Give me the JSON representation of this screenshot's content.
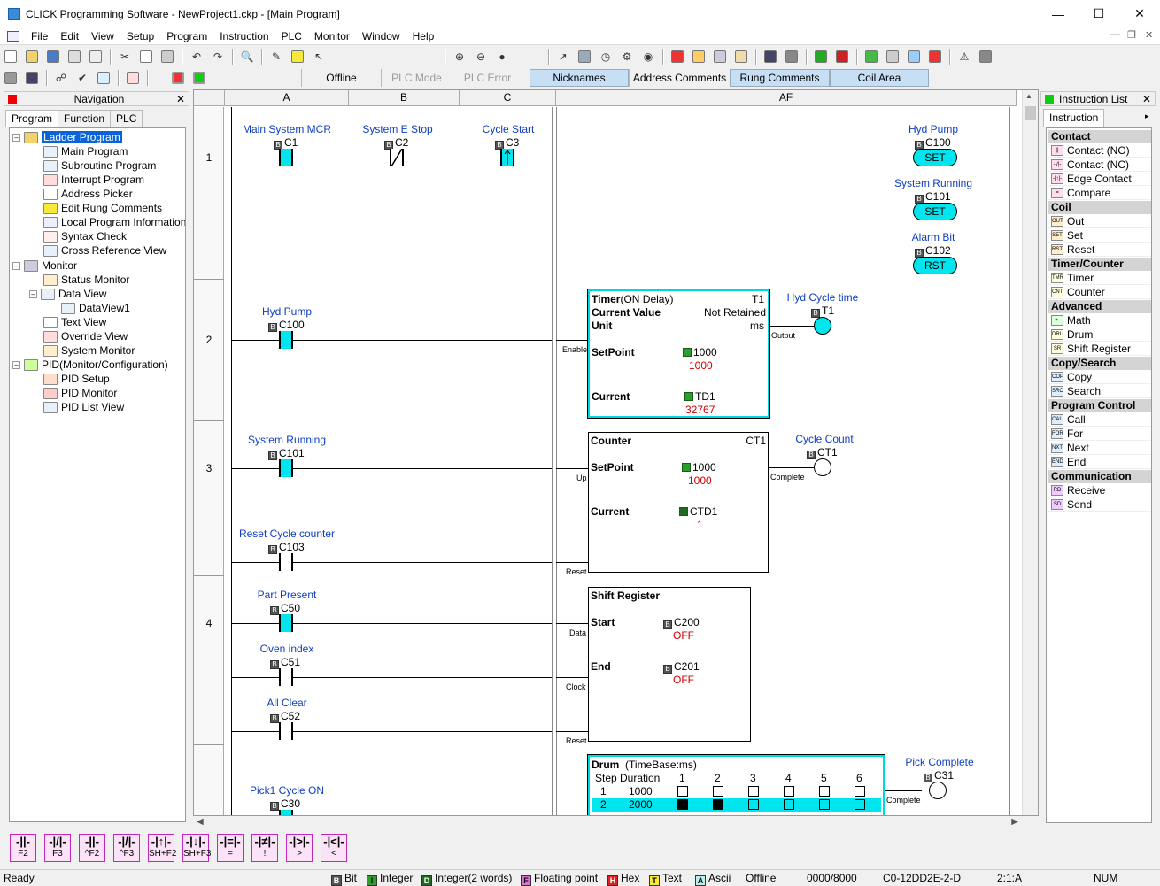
{
  "window": {
    "title": "CLICK Programming Software - NewProject1.ckp - [Main Program]"
  },
  "menu": [
    "File",
    "Edit",
    "View",
    "Setup",
    "Program",
    "Instruction",
    "PLC",
    "Monitor",
    "Window",
    "Help"
  ],
  "statusbar_top": {
    "offline": "Offline",
    "plc_mode": "PLC Mode",
    "plc_error": "PLC Error"
  },
  "view_buttons": {
    "nicknames": "Nicknames",
    "address_comments": "Address Comments",
    "rung_comments": "Rung Comments",
    "coil_area": "Coil Area"
  },
  "nav": {
    "title": "Navigation",
    "tabs": [
      "Program",
      "Function",
      "PLC"
    ],
    "tree": {
      "ladder": "Ladder Program",
      "main": "Main Program",
      "sub": "Subroutine Program",
      "interrupt": "Interrupt Program",
      "picker": "Address Picker",
      "rungcomments": "Edit Rung Comments",
      "local": "Local Program Information",
      "syntax": "Syntax Check",
      "xref": "Cross Reference View",
      "monitor": "Monitor",
      "status": "Status Monitor",
      "dataview": "Data View",
      "dataview1": "DataView1",
      "textview": "Text View",
      "override": "Override View",
      "sysmon": "System Monitor",
      "pid": "PID(Monitor/Configuration)",
      "pidsetup": "PID Setup",
      "pidmon": "PID Monitor",
      "pidlist": "PID List View"
    }
  },
  "ladder": {
    "cols": {
      "a": "A",
      "b": "B",
      "c": "C",
      "af": "AF"
    },
    "rungs": [
      "1",
      "2",
      "3",
      "4"
    ],
    "r1": {
      "c1_lbl": "Main System MCR",
      "c1": "C1",
      "c2_lbl": "System E Stop",
      "c2": "C2",
      "c3_lbl": "Cycle Start",
      "c3": "C3",
      "o1_lbl": "Hyd Pump",
      "o1": "C100",
      "o1_type": "SET",
      "o2_lbl": "System Running",
      "o2": "C101",
      "o2_type": "SET",
      "o3_lbl": "Alarm Bit",
      "o3": "C102",
      "o3_type": "RST"
    },
    "r2": {
      "c_lbl": "Hyd Pump",
      "c": "C100",
      "enable": "Enable",
      "output": "Output",
      "timer_title": "Timer",
      "timer_mode": "(ON Delay)",
      "timer_id": "T1",
      "cv": "Current Value",
      "retained": "Not Retained",
      "unit": "Unit",
      "unit_val": "ms",
      "sp": "SetPoint",
      "sp_addr": "1000",
      "sp_val": "1000",
      "cur": "Current",
      "cur_addr": "TD1",
      "cur_val": "32767",
      "out_lbl": "Hyd Cycle time",
      "out": "T1"
    },
    "r3": {
      "c_lbl": "System Running",
      "c": "C101",
      "c2_lbl": "Reset Cycle counter",
      "c2": "C103",
      "up": "Up",
      "reset": "Reset",
      "complete": "Complete",
      "title": "Counter",
      "id": "CT1",
      "sp": "SetPoint",
      "sp_addr": "1000",
      "sp_val": "1000",
      "cur": "Current",
      "cur_addr": "CTD1",
      "cur_val": "1",
      "out_lbl": "Cycle Count",
      "out": "CT1"
    },
    "r4": {
      "c1_lbl": "Part Present",
      "c1": "C50",
      "c2_lbl": "Oven index",
      "c2": "C51",
      "c3_lbl": "All Clear",
      "c3": "C52",
      "data": "Data",
      "clock": "Clock",
      "reset": "Reset",
      "title": "Shift Register",
      "start": "Start",
      "start_addr": "C200",
      "start_val": "OFF",
      "end": "End",
      "end_addr": "C201",
      "end_val": "OFF"
    },
    "r5": {
      "c_lbl": "Pick1 Cycle ON",
      "c": "C30",
      "drum_title": "Drum",
      "drum_tb": "(TimeBase:ms)",
      "step": "Step",
      "duration": "Duration",
      "cols": [
        "1",
        "2",
        "3",
        "4",
        "5",
        "6"
      ],
      "rows": [
        {
          "step": "1",
          "dur": "1000"
        },
        {
          "step": "2",
          "dur": "2000"
        }
      ],
      "complete": "Complete",
      "out_lbl": "Pick Complete",
      "out": "C31"
    }
  },
  "instr": {
    "title": "Instruction List",
    "tab": "Instruction",
    "groups": {
      "contact": "Contact",
      "coil": "Coil",
      "timer": "Timer/Counter",
      "adv": "Advanced",
      "copy": "Copy/Search",
      "prog": "Program Control",
      "comm": "Communication"
    },
    "items": {
      "no": "Contact (NO)",
      "nc": "Contact (NC)",
      "edge": "Edge Contact",
      "compare": "Compare",
      "out": "Out",
      "set": "Set",
      "reset": "Reset",
      "timer": "Timer",
      "counter": "Counter",
      "math": "Math",
      "drum": "Drum",
      "shift": "Shift Register",
      "copy": "Copy",
      "search": "Search",
      "call": "Call",
      "for": "For",
      "next": "Next",
      "end": "End",
      "recv": "Receive",
      "send": "Send"
    }
  },
  "fkeys": [
    "F2",
    "F3",
    "^F2",
    "^F3",
    "SH+F2",
    "SH+F3",
    "=",
    "!",
    ">",
    "<"
  ],
  "status": {
    "ready": "Ready",
    "bit": "Bit",
    "int": "Integer",
    "int2": "Integer(2 words)",
    "float": "Floating point",
    "hex": "Hex",
    "text": "Text",
    "ascii": "Ascii",
    "offline": "Offline",
    "mem": "0000/8000",
    "cpu": "C0-12DD2E-2-D",
    "pos": "2:1:A",
    "num": "NUM"
  }
}
